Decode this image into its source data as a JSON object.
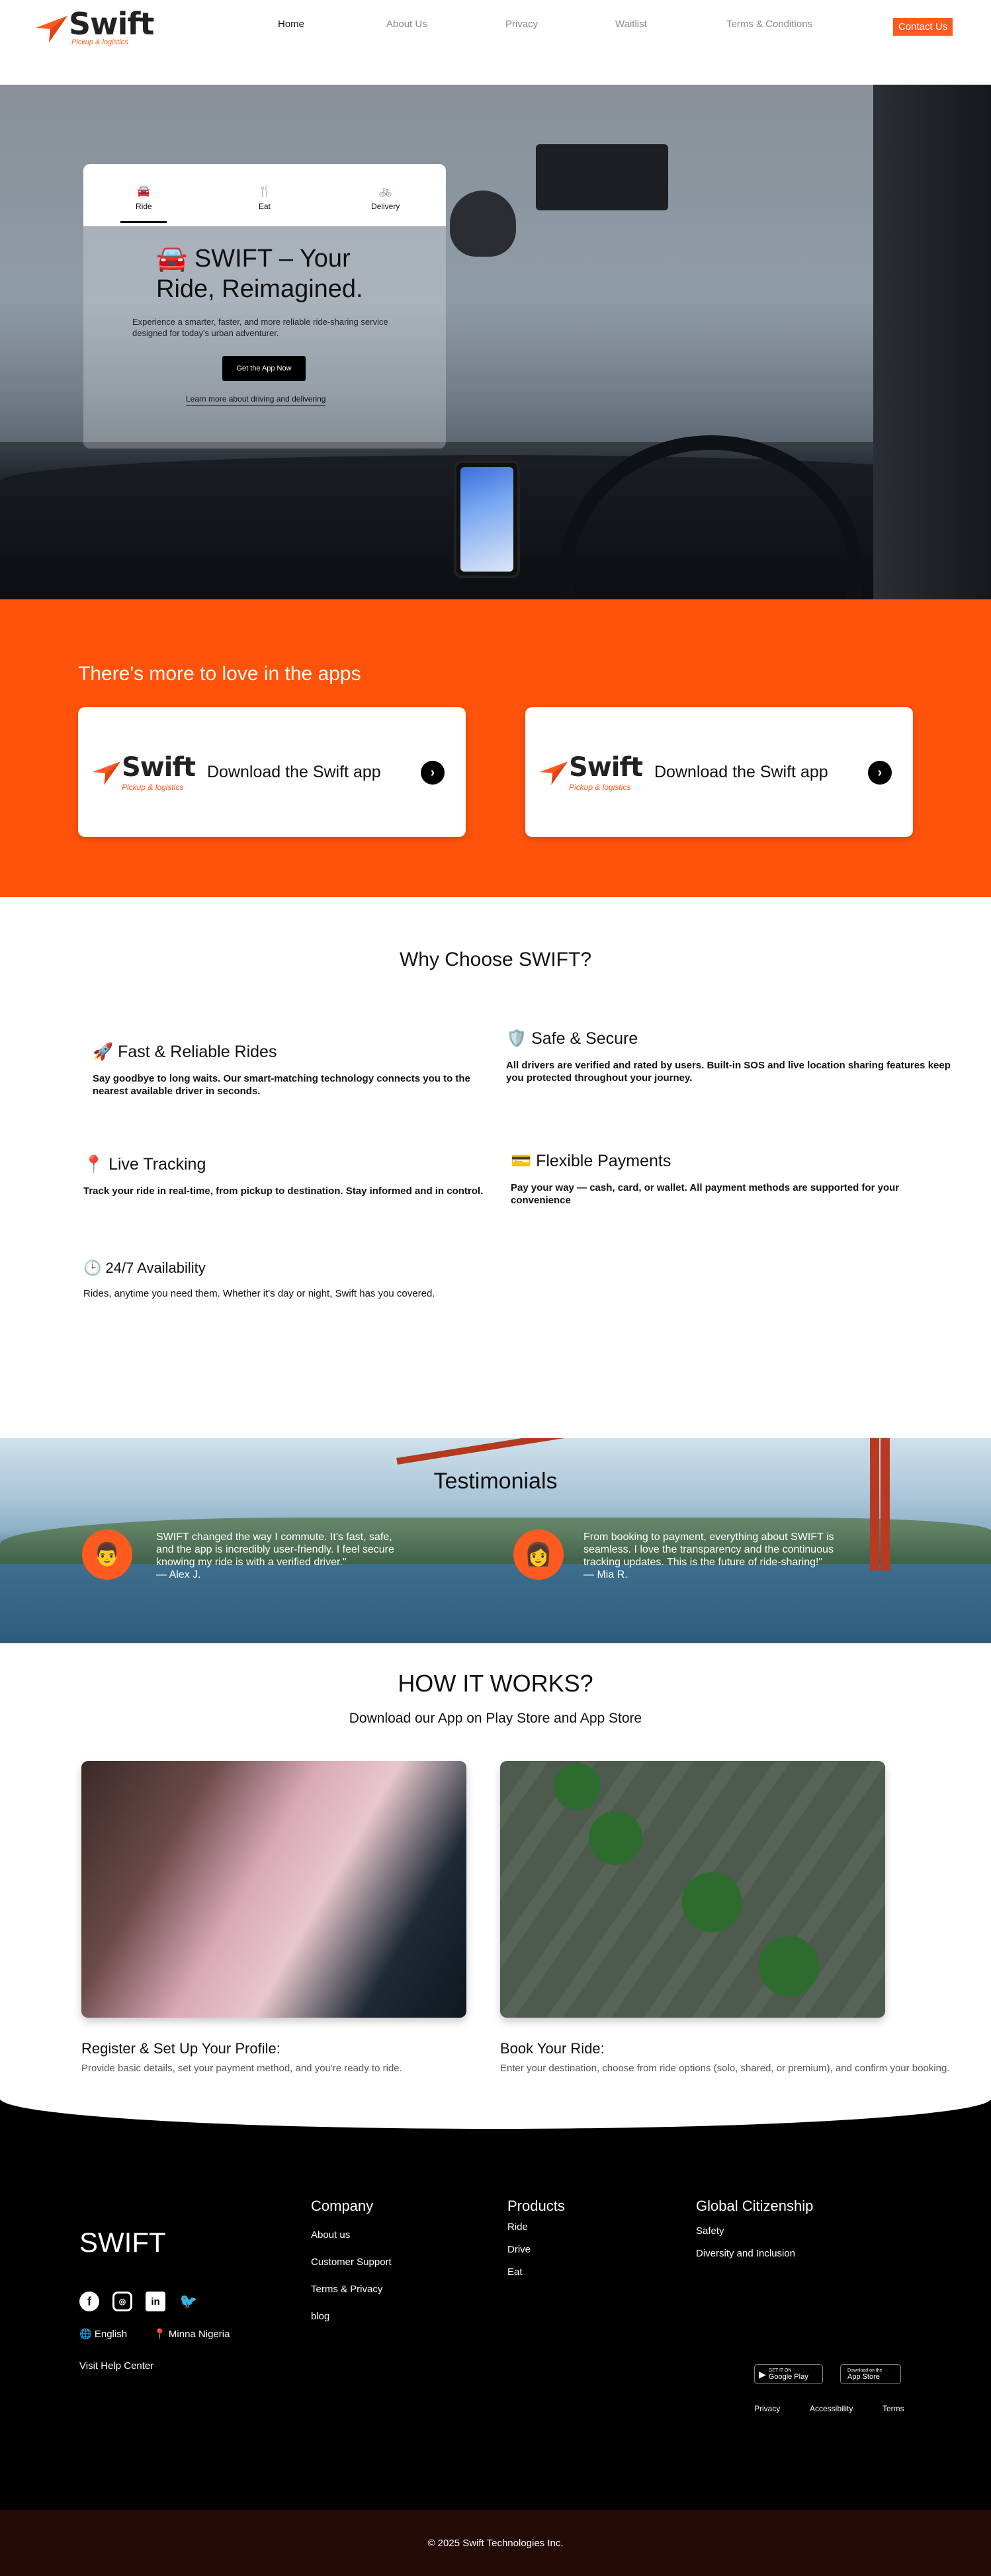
{
  "brand": {
    "name": "Swift",
    "tagline": "Pickup & logistics",
    "accent": "#ff520b"
  },
  "nav": {
    "links": [
      "Home",
      "About Us",
      "Privacy",
      "Waitlist",
      "Terms & Conditions"
    ],
    "contact": "Contact Us"
  },
  "hero": {
    "tabs": [
      {
        "icon": "car-icon",
        "label": "Ride"
      },
      {
        "icon": "utensils-icon",
        "label": "Eat"
      },
      {
        "icon": "bicycle-icon",
        "label": "Delivery"
      }
    ],
    "title": "🚘 SWIFT – Your Ride, Reimagined.",
    "subtitle": "Experience a smarter, faster, and more reliable ride-sharing service designed for today's urban adventurer.",
    "cta": "Get the App Now",
    "link": "Learn more about driving and delivering"
  },
  "apps": {
    "heading": "There's more to love in the apps",
    "cards": [
      {
        "label": "Download the Swift app"
      },
      {
        "label": "Download the Swift app"
      }
    ]
  },
  "why": {
    "heading": "Why Choose SWIFT?",
    "features": [
      {
        "title": "🚀 Fast & Reliable Rides",
        "text": "Say goodbye to long waits. Our smart-matching technology connects you to the nearest available driver in seconds."
      },
      {
        "title": "🛡️ Safe & Secure",
        "text": "All drivers are verified and rated by users. Built-in SOS and live location sharing features keep you protected throughout your journey."
      },
      {
        "title": "📍 Live Tracking",
        "text": "Track your ride in real-time, from pickup to destination. Stay informed and in control."
      },
      {
        "title": "💳 Flexible Payments",
        "text": "Pay your way — cash, card, or wallet. All payment methods are supported for your convenience"
      },
      {
        "title": "🕒 24/7 Availability",
        "text": "Rides, anytime you need them. Whether it's day or night, Swift has you covered."
      }
    ]
  },
  "testimonials": {
    "heading": "Testimonials",
    "items": [
      {
        "avatar": "👨",
        "quote": "SWIFT changed the way I commute. It's fast, safe, and the app is incredibly user-friendly. I feel secure knowing my ride is with a verified driver.\"",
        "author": "— Alex J."
      },
      {
        "avatar": "👩",
        "quote": "From booking to payment, everything about SWIFT is seamless. I love the transparency and the continuous tracking updates. This is the future of ride-sharing!\"",
        "author": "— Mia R."
      }
    ]
  },
  "how": {
    "heading": "HOW IT WORKS?",
    "subheading": "Download our App on Play Store and App Store",
    "steps": [
      {
        "title": "Register & Set Up Your Profile:",
        "text": "Provide basic details, set your payment method, and you're ready to ride."
      },
      {
        "title": "Book Your Ride:",
        "text": "Enter your destination, choose from ride options (solo, shared, or premium), and confirm your booking."
      }
    ]
  },
  "footer": {
    "brand": "SWIFT",
    "language": "English",
    "location": "Minna Nigeria",
    "help": "Visit Help Center",
    "company": {
      "title": "Company",
      "items": [
        "About us",
        "Customer Support",
        "Terms & Privacy",
        "blog"
      ]
    },
    "products": {
      "title": "Products",
      "items": [
        "Ride",
        "Drive",
        "Eat"
      ]
    },
    "citizenship": {
      "title": "Global Citizenship",
      "items": [
        "Safety",
        "Diversity and Inclusion"
      ]
    },
    "stores": {
      "google": "Google Play",
      "apple": "App Store",
      "google_small": "GET IT ON",
      "apple_small": "Download on the"
    },
    "legal": [
      "Privacy",
      "Accessibility",
      "Terms"
    ],
    "copyright": "© 2025 Swift Technologies Inc."
  }
}
